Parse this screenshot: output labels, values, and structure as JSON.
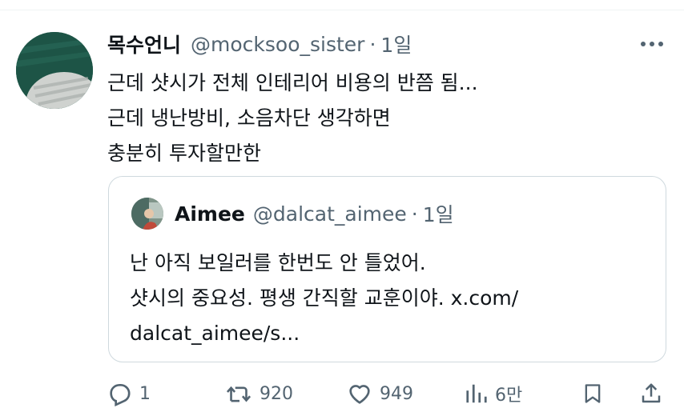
{
  "tweet": {
    "display_name": "목수언니",
    "handle": "@mocksoo_sister",
    "separator": "·",
    "time": "1일",
    "lines": [
      "근데 샷시가 전체 인테리어 비용의 반쯤 됨...",
      "근데 냉난방비, 소음차단 생각하면",
      "충분히 투자할만한"
    ]
  },
  "quote": {
    "display_name": "Aimee",
    "handle": "@dalcat_aimee",
    "separator": "·",
    "time": "1일",
    "lines": [
      "난 아직 보일러를 한번도 안 틀었어.",
      "샷시의 중요성. 평생 간직할 교훈이야. x.com/",
      "dalcat_aimee/s..."
    ]
  },
  "actions": {
    "reply_count": "1",
    "repost_count": "920",
    "like_count": "949",
    "views_count": "6만"
  },
  "icons": {
    "more": "more-dots-icon",
    "reply": "reply-bubble-icon",
    "repost": "repost-arrows-icon",
    "like": "heart-icon",
    "views": "views-bars-icon",
    "bookmark": "bookmark-icon",
    "share": "share-upload-icon"
  },
  "colors": {
    "text": "#0f1419",
    "secondary": "#536471",
    "border": "#cfd9de"
  }
}
